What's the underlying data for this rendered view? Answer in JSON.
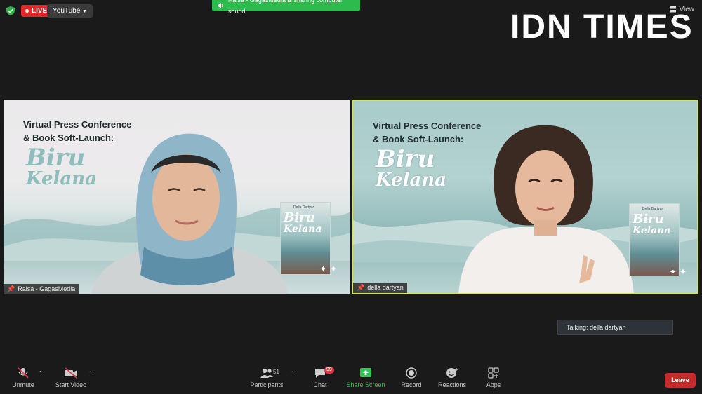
{
  "top": {
    "live_label": "LIVE",
    "stream_target": "YouTube",
    "share_banner": "Raisa - GagasMedia is sharing computer sound",
    "view_label": "View"
  },
  "brand": "IDN TIMES",
  "tiles": [
    {
      "name": "Raisa - GagasMedia",
      "promo_line1": "Virtual Press Conference",
      "promo_line2": "& Book Soft-Launch:",
      "book_title_line1": "Biru",
      "book_title_line2": "Kelana",
      "book_author": "Della Dartyan"
    },
    {
      "name": "della dartyan",
      "promo_line1": "Virtual Press Conference",
      "promo_line2": "& Book Soft-Launch:",
      "book_title_line1": "Biru",
      "book_title_line2": "Kelana",
      "book_author": "Della Dartyan"
    }
  ],
  "talking": "Talking: della dartyan",
  "toolbar": {
    "unmute": "Unmute",
    "start_video": "Start Video",
    "participants": "Participants",
    "participants_count": "51",
    "chat": "Chat",
    "chat_badge": "99",
    "share_screen": "Share Screen",
    "record": "Record",
    "reactions": "Reactions",
    "apps": "Apps",
    "leave": "Leave"
  },
  "colors": {
    "live_red": "#e02828",
    "share_green": "#2dbb4e",
    "active_speaker_border": "#d7e26a",
    "leave_red": "#c52b2b"
  }
}
